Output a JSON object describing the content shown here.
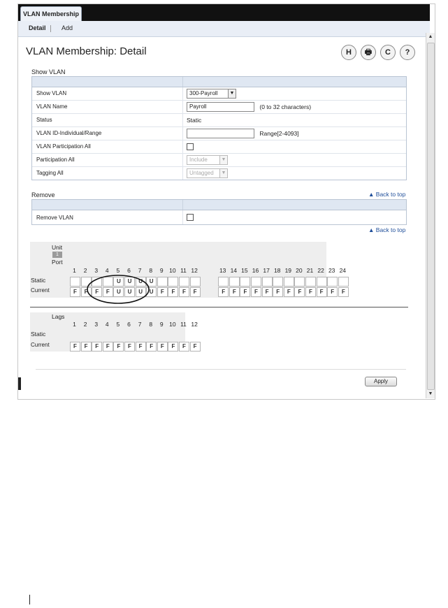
{
  "window": {
    "main_tab": "VLAN Membership"
  },
  "subnav": {
    "tabs": [
      {
        "label": "Detail",
        "active": true
      },
      {
        "label": "Add",
        "active": false
      }
    ]
  },
  "page": {
    "title": "VLAN Membership: Detail"
  },
  "toolbar": {
    "icons": [
      {
        "name": "save-icon",
        "glyph": "H"
      },
      {
        "name": "print-icon",
        "glyph": "🖶"
      },
      {
        "name": "refresh-icon",
        "glyph": "C"
      },
      {
        "name": "help-icon",
        "glyph": "?"
      }
    ]
  },
  "show_vlan": {
    "section_title": "Show VLAN",
    "rows": {
      "show_vlan": {
        "label": "Show VLAN",
        "value": "300-Payroll"
      },
      "vlan_name": {
        "label": "VLAN Name",
        "value": "Payroll",
        "hint": "(0 to 32 characters)"
      },
      "status": {
        "label": "Status",
        "value": "Static"
      },
      "vlan_id": {
        "label": "VLAN ID-Individual/Range",
        "value": "",
        "hint": "Range[2-4093]"
      },
      "participation_all_chk": {
        "label": "VLAN Participation All"
      },
      "participation_all": {
        "label": "Participation All",
        "value": "Include"
      },
      "tagging_all": {
        "label": "Tagging All",
        "value": "Untagged"
      }
    }
  },
  "remove": {
    "section_title": "Remove",
    "back_to_top": "▲ Back to top",
    "row_label": "Remove VLAN",
    "back_to_top_2": "▲ Back to top"
  },
  "ports": {
    "unit_label": "Unit",
    "unit_value": "1",
    "port_label": "Port",
    "static_label": "Static",
    "current_label": "Current",
    "numbers": [
      "1",
      "2",
      "3",
      "4",
      "5",
      "6",
      "7",
      "8",
      "9",
      "10",
      "11",
      "12",
      "13",
      "14",
      "15",
      "16",
      "17",
      "18",
      "19",
      "20",
      "21",
      "22",
      "23",
      "24"
    ],
    "static": [
      "",
      "",
      "",
      "",
      "U",
      "U",
      "U",
      "U",
      "",
      "",
      "",
      "",
      "",
      "",
      "",
      "",
      "",
      "",
      "",
      "",
      "",
      "",
      "",
      ""
    ],
    "current": [
      "F",
      "F",
      "F",
      "F",
      "U",
      "U",
      "U",
      "U",
      "F",
      "F",
      "F",
      "F",
      "F",
      "F",
      "F",
      "F",
      "F",
      "F",
      "F",
      "F",
      "F",
      "F",
      "F",
      "F"
    ]
  },
  "lags": {
    "lags_label": "Lags",
    "static_label": "Static",
    "current_label": "Current",
    "numbers": [
      "1",
      "2",
      "3",
      "4",
      "5",
      "6",
      "7",
      "8",
      "9",
      "10",
      "11",
      "12"
    ],
    "current": [
      "F",
      "F",
      "F",
      "F",
      "F",
      "F",
      "F",
      "F",
      "F",
      "F",
      "F",
      "F"
    ]
  },
  "actions": {
    "apply": "Apply"
  },
  "scrollbar": {
    "up": "▲",
    "down": "▼"
  }
}
